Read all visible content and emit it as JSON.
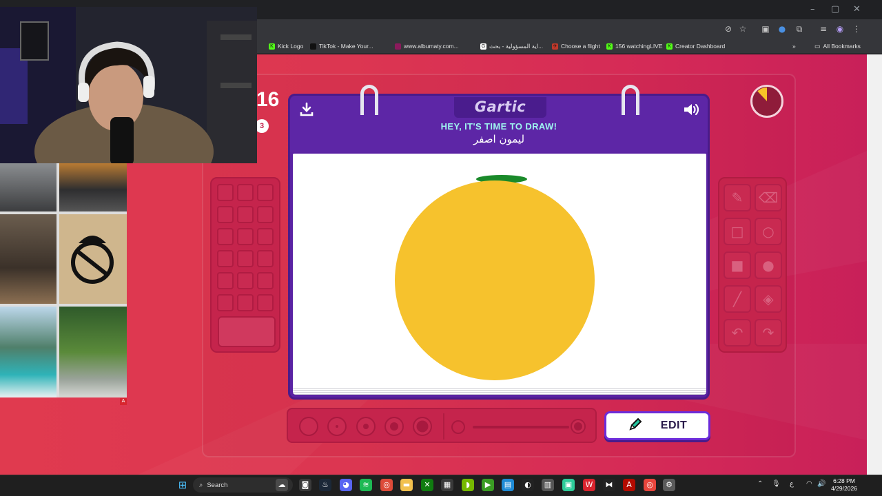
{
  "window_controls": {
    "minimize": "–",
    "maximize": "▢",
    "close": "✕"
  },
  "bookmarks": [
    {
      "label": "Kick Logo",
      "color": "#53fc18",
      "letter": "K"
    },
    {
      "label": "TikTok - Make Your...",
      "color": "#111111",
      "letter": "♪"
    },
    {
      "label": "www.albumaty.com...",
      "color": "#8b1a5c",
      "letter": ""
    },
    {
      "label": "اية المسؤولية - بحث...",
      "color": "#ffffff",
      "letter": "G"
    },
    {
      "label": "Choose a flight",
      "color": "#c0392b",
      "letter": "✈"
    },
    {
      "label": "156 watchingLIVE",
      "color": "#53fc18",
      "letter": "K"
    },
    {
      "label": "Creator Dashboard",
      "color": "#53fc18",
      "letter": "K"
    }
  ],
  "bookmarks_overflow": "»",
  "all_bookmarks": "All Bookmarks",
  "game": {
    "score": "16",
    "score_badge": "3",
    "timer_fraction_elapsed": 0.12,
    "logo": "Gartic",
    "headline": "HEY, IT'S TIME TO DRAW!",
    "word": "ليمون اصفر",
    "download_icon": "download-icon",
    "sound_icon": "speaker-icon",
    "edit_label": "EDIT",
    "drawing": {
      "circle_color": "#f6c22d",
      "stem_color": "#1a8a2a"
    },
    "tools": [
      {
        "name": "pencil-tool",
        "glyph": "✎"
      },
      {
        "name": "eraser-tool",
        "glyph": "⌫"
      },
      {
        "name": "rectangle-outline-tool",
        "glyph": "□"
      },
      {
        "name": "ellipse-outline-tool",
        "glyph": "○"
      },
      {
        "name": "rectangle-fill-tool",
        "glyph": "■"
      },
      {
        "name": "ellipse-fill-tool",
        "glyph": "●"
      },
      {
        "name": "line-tool",
        "glyph": "╱"
      },
      {
        "name": "fill-bucket-tool",
        "glyph": "◈"
      },
      {
        "name": "undo-tool",
        "glyph": "↶"
      },
      {
        "name": "redo-tool",
        "glyph": "↷"
      }
    ]
  },
  "taskbar": {
    "search_label": "Search",
    "clock_time": "6:28 PM",
    "clock_date": "4/29/2026",
    "lang": "ع"
  }
}
